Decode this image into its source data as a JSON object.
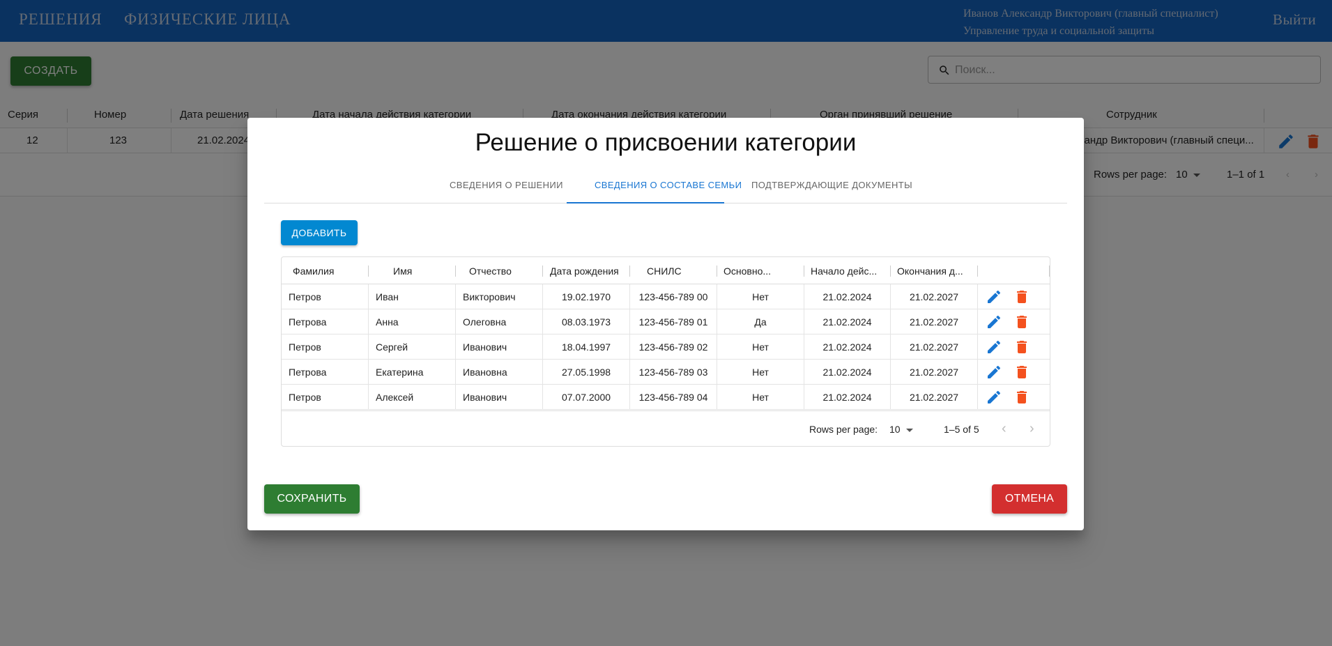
{
  "appbar": {
    "nav_decisions": "РЕШЕНИЯ",
    "nav_persons": "ФИЗИЧЕСКИЕ ЛИЦА",
    "user_name": "Иванов Александр Викторович (главный специалист)",
    "user_org": "Управление труда и социальной защиты",
    "logout": "Выйти"
  },
  "toolbar": {
    "create_label": "СОЗДАТЬ",
    "search_placeholder": "Поиск..."
  },
  "background_table": {
    "columns": [
      "Серия",
      "Номер",
      "Дата решения",
      "Дата начала действия категории",
      "Дата окончания действия категории",
      "Орган принявший решение",
      "Сотрудник"
    ],
    "row": {
      "series": "12",
      "number": "123",
      "date": "21.02.2024",
      "employee": "сандр Викторович (главный специ..."
    },
    "rows_per_page_label": "Rows per page:",
    "rows_per_page": "10",
    "range": "1–1 of 1"
  },
  "dialog": {
    "title": "Решение о присвоении категории",
    "tabs": [
      "СВЕДЕНИЯ О РЕШЕНИИ",
      "СВЕДЕНИЯ О СОСТАВЕ СЕМЬИ",
      "ПОДТВЕРЖДАЮЩИЕ ДОКУМЕНТЫ"
    ],
    "active_tab": "СВЕДЕНИЯ О СОСТАВЕ СЕМЬИ",
    "add_label": "ДОБАВИТЬ",
    "columns": [
      "Фамилия",
      "Имя",
      "Отчество",
      "Дата рождения",
      "СНИЛС",
      "Основно...",
      "Начало дейс...",
      "Окончания д..."
    ],
    "rows": [
      [
        "Петров",
        "Иван",
        "Викторович",
        "19.02.1970",
        "123-456-789 00",
        "Нет",
        "21.02.2024",
        "21.02.2027"
      ],
      [
        "Петрова",
        "Анна",
        "Олеговна",
        "08.03.1973",
        "123-456-789 01",
        "Да",
        "21.02.2024",
        "21.02.2027"
      ],
      [
        "Петров",
        "Сергей",
        "Иванович",
        "18.04.1997",
        "123-456-789 02",
        "Нет",
        "21.02.2024",
        "21.02.2027"
      ],
      [
        "Петрова",
        "Екатерина",
        "Ивановна",
        "27.05.1998",
        "123-456-789 03",
        "Нет",
        "21.02.2024",
        "21.02.2027"
      ],
      [
        "Петров",
        "Алексей",
        "Иванович",
        "07.07.2000",
        "123-456-789 04",
        "Нет",
        "21.02.2024",
        "21.02.2027"
      ]
    ],
    "rows_per_page_label": "Rows per page:",
    "rows_per_page": "10",
    "range": "1–5 of 5",
    "save_label": "СОХРАНИТЬ",
    "cancel_label": "ОТМЕНА"
  },
  "colors": {
    "appbar": "#1565c0",
    "save_green": "#2e7d32",
    "add_blue": "#0288d1",
    "cancel_red": "#d32f2f",
    "edit_icon": "#1976d2",
    "delete_icon": "#f4511e"
  },
  "icons": [
    "search-icon",
    "edit-icon",
    "delete-icon",
    "chevron-left-icon",
    "chevron-right-icon",
    "dropdown-arrow-icon"
  ]
}
